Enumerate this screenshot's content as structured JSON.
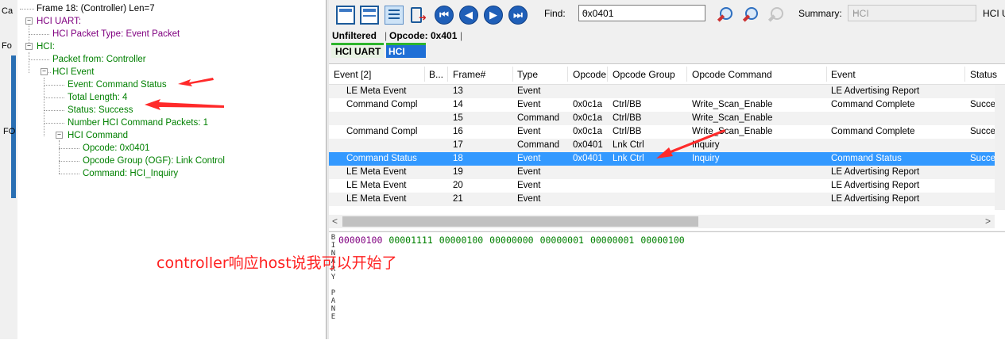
{
  "background": {
    "fragments": [
      "Ca",
      "Fo",
      "FO"
    ]
  },
  "tree": {
    "nodes": [
      {
        "text": "Frame 18: (Controller) Len=7"
      },
      {
        "text": "HCI UART:"
      },
      {
        "text": "HCI Packet Type: Event Packet"
      },
      {
        "text": "HCI:"
      },
      {
        "text": "Packet from: Controller"
      },
      {
        "text": "HCI Event"
      },
      {
        "text": "Event: Command Status"
      },
      {
        "text": "Total Length: 4"
      },
      {
        "text": "Status: Success"
      },
      {
        "text": "Number HCI Command Packets: 1"
      },
      {
        "text": "HCI Command"
      },
      {
        "text": "Opcode: 0x0401"
      },
      {
        "text": "Opcode Group (OGF): Link Control"
      },
      {
        "text": "Command: HCI_Inquiry"
      }
    ]
  },
  "toolbar": {
    "find_label": "Find:",
    "find_value": "0x0401",
    "summary_label": "Summary:",
    "summary_value": "HCI",
    "summary_tail": "HCI U"
  },
  "tabs": {
    "filter_tabs": [
      "Unfiltered",
      "Opcode: 0x401"
    ],
    "protocol_tabs": [
      "HCI UART",
      "HCI"
    ]
  },
  "table": {
    "columns": [
      "Event [2]",
      "B...",
      "Frame#",
      "Type",
      "Opcode",
      "Opcode Group",
      "Opcode Command",
      "Event",
      "Status"
    ],
    "rows": [
      {
        "event2": "LE Meta Event",
        "b": "",
        "frame": "13",
        "type": "Event",
        "opcode": "",
        "group": "",
        "command": "",
        "event": "LE Advertising Report",
        "status": ""
      },
      {
        "event2": "Command Compl",
        "b": "",
        "frame": "14",
        "type": "Event",
        "opcode": "0x0c1a",
        "group": "Ctrl/BB",
        "command": "Write_Scan_Enable",
        "event": "Command Complete",
        "status": "Succes"
      },
      {
        "event2": "",
        "b": "",
        "frame": "15",
        "type": "Command",
        "opcode": "0x0c1a",
        "group": "Ctrl/BB",
        "command": "Write_Scan_Enable",
        "event": "",
        "status": ""
      },
      {
        "event2": "Command Compl",
        "b": "",
        "frame": "16",
        "type": "Event",
        "opcode": "0x0c1a",
        "group": "Ctrl/BB",
        "command": "Write_Scan_Enable",
        "event": "Command Complete",
        "status": "Succes"
      },
      {
        "event2": "",
        "b": "",
        "frame": "17",
        "type": "Command",
        "opcode": "0x0401",
        "group": "Lnk Ctrl",
        "command": "Inquiry",
        "event": "",
        "status": ""
      },
      {
        "event2": "Command Status",
        "b": "",
        "frame": "18",
        "type": "Event",
        "opcode": "0x0401",
        "group": "Lnk Ctrl",
        "command": "Inquiry",
        "event": "Command Status",
        "status": "Succes"
      },
      {
        "event2": "LE Meta Event",
        "b": "",
        "frame": "19",
        "type": "Event",
        "opcode": "",
        "group": "",
        "command": "",
        "event": "LE Advertising Report",
        "status": ""
      },
      {
        "event2": "LE Meta Event",
        "b": "",
        "frame": "20",
        "type": "Event",
        "opcode": "",
        "group": "",
        "command": "",
        "event": "LE Advertising Report",
        "status": ""
      },
      {
        "event2": "LE Meta Event",
        "b": "",
        "frame": "21",
        "type": "Event",
        "opcode": "",
        "group": "",
        "command": "",
        "event": "LE Advertising Report",
        "status": ""
      }
    ],
    "selected_frame": "18"
  },
  "binary": {
    "label": "BINARY PANE",
    "bytes": [
      "00000100",
      "00001111",
      "00000100",
      "00000000",
      "00000001",
      "00000001",
      "00000100"
    ]
  },
  "annotation": {
    "text": "controller响应host说我可以开始了",
    "color": "#ff2020"
  },
  "colors": {
    "tree_purple": "#800080",
    "tree_green": "#008000",
    "selection": "#3399ff",
    "hci_tab": "#1f6fd6",
    "tab_accent": "#2db52d"
  }
}
